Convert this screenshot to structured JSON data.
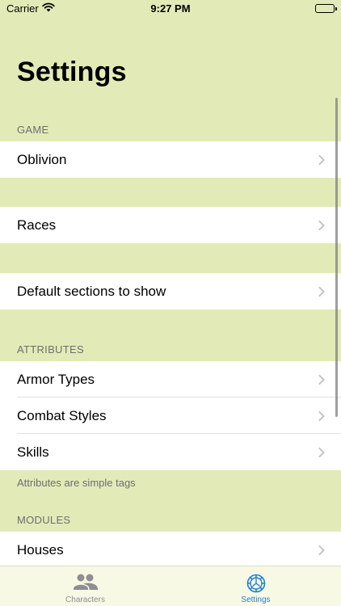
{
  "status_bar": {
    "carrier": "Carrier",
    "time": "9:27 PM"
  },
  "title": "Settings",
  "sections": {
    "game": {
      "header": "GAME",
      "rows": [
        {
          "label": "Oblivion"
        }
      ],
      "second_rows": [
        {
          "label": "Races"
        }
      ],
      "third_rows": [
        {
          "label": "Default sections to show"
        }
      ]
    },
    "attributes": {
      "header": "ATTRIBUTES",
      "rows": [
        {
          "label": "Armor Types"
        },
        {
          "label": "Combat Styles"
        },
        {
          "label": "Skills"
        }
      ],
      "footer": "Attributes are simple tags"
    },
    "modules": {
      "header": "MODULES",
      "rows": [
        {
          "label": "Houses"
        }
      ]
    }
  },
  "tab_bar": {
    "items": [
      {
        "label": "Characters",
        "icon": "people-icon",
        "selected": false
      },
      {
        "label": "Settings",
        "icon": "gear-icon",
        "selected": true
      }
    ]
  },
  "colors": {
    "background": "#e2ebb7",
    "accent": "#1c7fd8",
    "inactive_tab": "#8e8e93"
  }
}
